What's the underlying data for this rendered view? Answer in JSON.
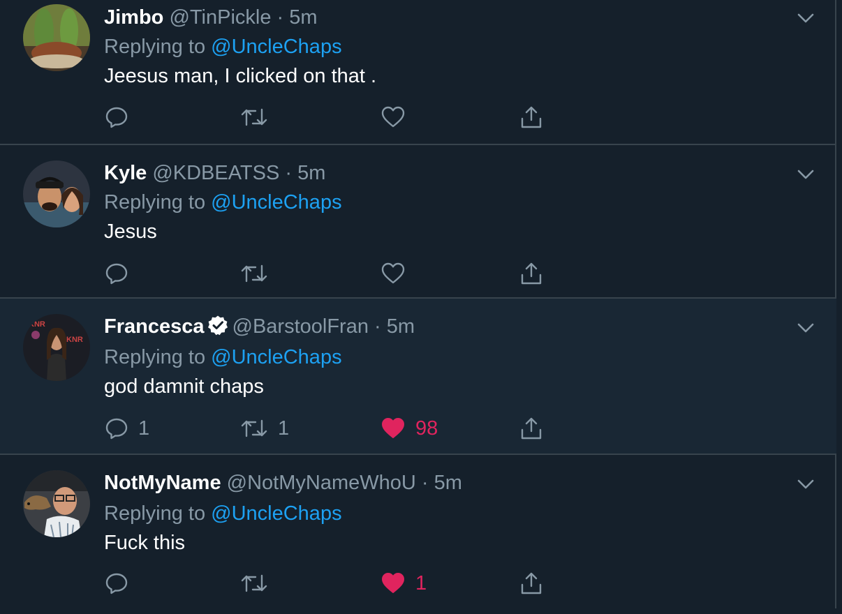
{
  "timeline": {
    "replying_prefix": "Replying to",
    "tweets": [
      {
        "name": "Jimbo",
        "handle": "@TinPickle",
        "separator": "·",
        "time": "5m",
        "mention": "@UncleChaps",
        "text": "Jeesus man, I clicked on that .",
        "reply_count": "",
        "retweet_count": "",
        "like_count": "",
        "liked": false
      },
      {
        "name": "Kyle",
        "handle": "@KDBEATSS",
        "separator": "·",
        "time": "5m",
        "mention": "@UncleChaps",
        "text": "Jesus",
        "reply_count": "",
        "retweet_count": "",
        "like_count": "",
        "liked": false
      },
      {
        "name": "Francesca",
        "verified": true,
        "handle": "@BarstoolFran",
        "separator": "·",
        "time": "5m",
        "mention": "@UncleChaps",
        "text": "god damnit chaps",
        "reply_count": "1",
        "retweet_count": "1",
        "like_count": "98",
        "liked": true
      },
      {
        "name": "NotMyName",
        "handle": "@NotMyNameWhoU",
        "separator": "·",
        "time": "5m",
        "mention": "@UncleChaps",
        "text": "Fuck this",
        "reply_count": "",
        "retweet_count": "",
        "like_count": "1",
        "liked": true
      }
    ]
  },
  "colors": {
    "background": "#15202b",
    "highlight_background": "#192734",
    "border": "#38444d",
    "secondary_text": "#8899a6",
    "link": "#1da1f2",
    "like": "#e0245e"
  }
}
